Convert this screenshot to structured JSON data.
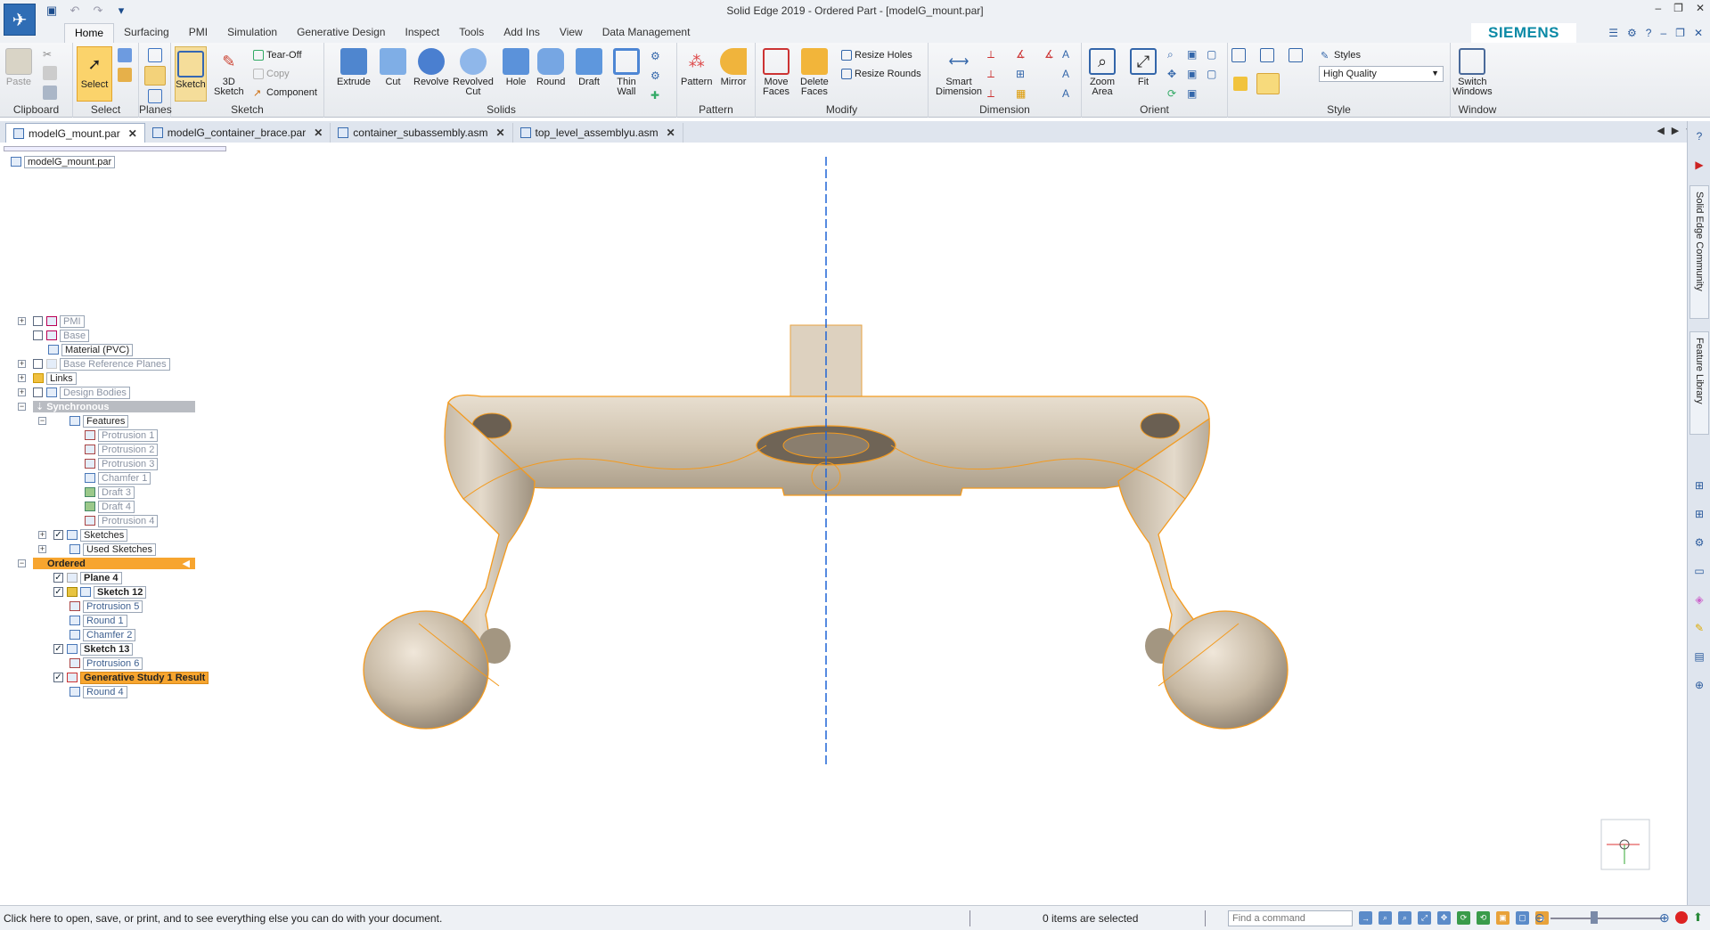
{
  "window": {
    "title": "Solid Edge 2019 - Ordered Part - [modelG_mount.par]",
    "controls": [
      "–",
      "❐",
      "✕"
    ]
  },
  "ribbon_tabs": [
    "Home",
    "Surfacing",
    "PMI",
    "Simulation",
    "Generative Design",
    "Inspect",
    "Tools",
    "Add Ins",
    "View",
    "Data Management"
  ],
  "brand": "SIEMENS",
  "ribbon": {
    "clipboard": {
      "label": "Clipboard",
      "paste": "Paste"
    },
    "select": {
      "label": "Select",
      "select_btn": "Select"
    },
    "planes": {
      "label": "Planes"
    },
    "sketch": {
      "label": "Sketch",
      "sketch_btn": "Sketch",
      "sketch3d": "3D\nSketch",
      "tearoff": "Tear-Off",
      "copy": "Copy",
      "component": "Component"
    },
    "solids": {
      "label": "Solids",
      "extrude": "Extrude",
      "cut": "Cut",
      "revolve": "Revolve",
      "revolved_cut": "Revolved\nCut",
      "hole": "Hole",
      "round": "Round",
      "draft": "Draft",
      "thin_wall": "Thin\nWall"
    },
    "pattern": {
      "label": "Pattern",
      "pattern": "Pattern",
      "mirror": "Mirror"
    },
    "modify": {
      "label": "Modify",
      "move_faces": "Move\nFaces",
      "delete_faces": "Delete\nFaces",
      "resize_holes": "Resize Holes",
      "resize_rounds": "Resize Rounds"
    },
    "dimension": {
      "label": "Dimension",
      "smart_dimension": "Smart\nDimension"
    },
    "orient": {
      "label": "Orient",
      "zoom_area": "Zoom\nArea",
      "fit": "Fit"
    },
    "style": {
      "label": "Style",
      "styles": "Styles",
      "quality": "High Quality"
    },
    "window": {
      "label": "Window",
      "switch_windows": "Switch\nWindows"
    }
  },
  "doc_tabs": [
    {
      "name": "modelG_mount.par",
      "active": true
    },
    {
      "name": "modelG_container_brace.par",
      "active": false
    },
    {
      "name": "container_subassembly.asm",
      "active": false
    },
    {
      "name": "top_level_assemblyu.asm",
      "active": false
    }
  ],
  "tree": {
    "root": "modelG_mount.par",
    "pmi": "PMI",
    "base": "Base",
    "material": "Material (PVC)",
    "base_ref_planes": "Base Reference Planes",
    "links": "Links",
    "design_bodies": "Design Bodies",
    "synchronous": "Synchronous",
    "features": "Features",
    "feature_items": [
      "Protrusion 1",
      "Protrusion 2",
      "Protrusion 3",
      "Chamfer 1",
      "Draft 3",
      "Draft 4",
      "Protrusion 4"
    ],
    "sketches": "Sketches",
    "used_sketches": "Used Sketches",
    "ordered": "Ordered",
    "ordered_items": [
      {
        "label": "Plane 4",
        "checked": true
      },
      {
        "label": "Sketch 12",
        "checked": true
      },
      {
        "label": "Protrusion 5",
        "checked": false
      },
      {
        "label": "Round 1",
        "checked": false
      },
      {
        "label": "Chamfer 2",
        "checked": false
      },
      {
        "label": "Sketch 13",
        "checked": true
      },
      {
        "label": "Protrusion 6",
        "checked": false
      },
      {
        "label": "Generative Study 1 Result",
        "checked": true
      },
      {
        "label": "Round 4",
        "checked": false
      }
    ]
  },
  "right_dock": {
    "community": "Solid Edge Community",
    "library": "Feature Library"
  },
  "status": {
    "message": "Click here to open, save, or print, and to see everything else you can do with your document.",
    "selection": "0 items are selected",
    "find_placeholder": "Find a command"
  },
  "colors": {
    "accent": "#fbd36b",
    "edge": "#f39a1e",
    "part": "#d9ccb6",
    "axis": "#1f64d6",
    "highlight": "#f7a52f"
  }
}
